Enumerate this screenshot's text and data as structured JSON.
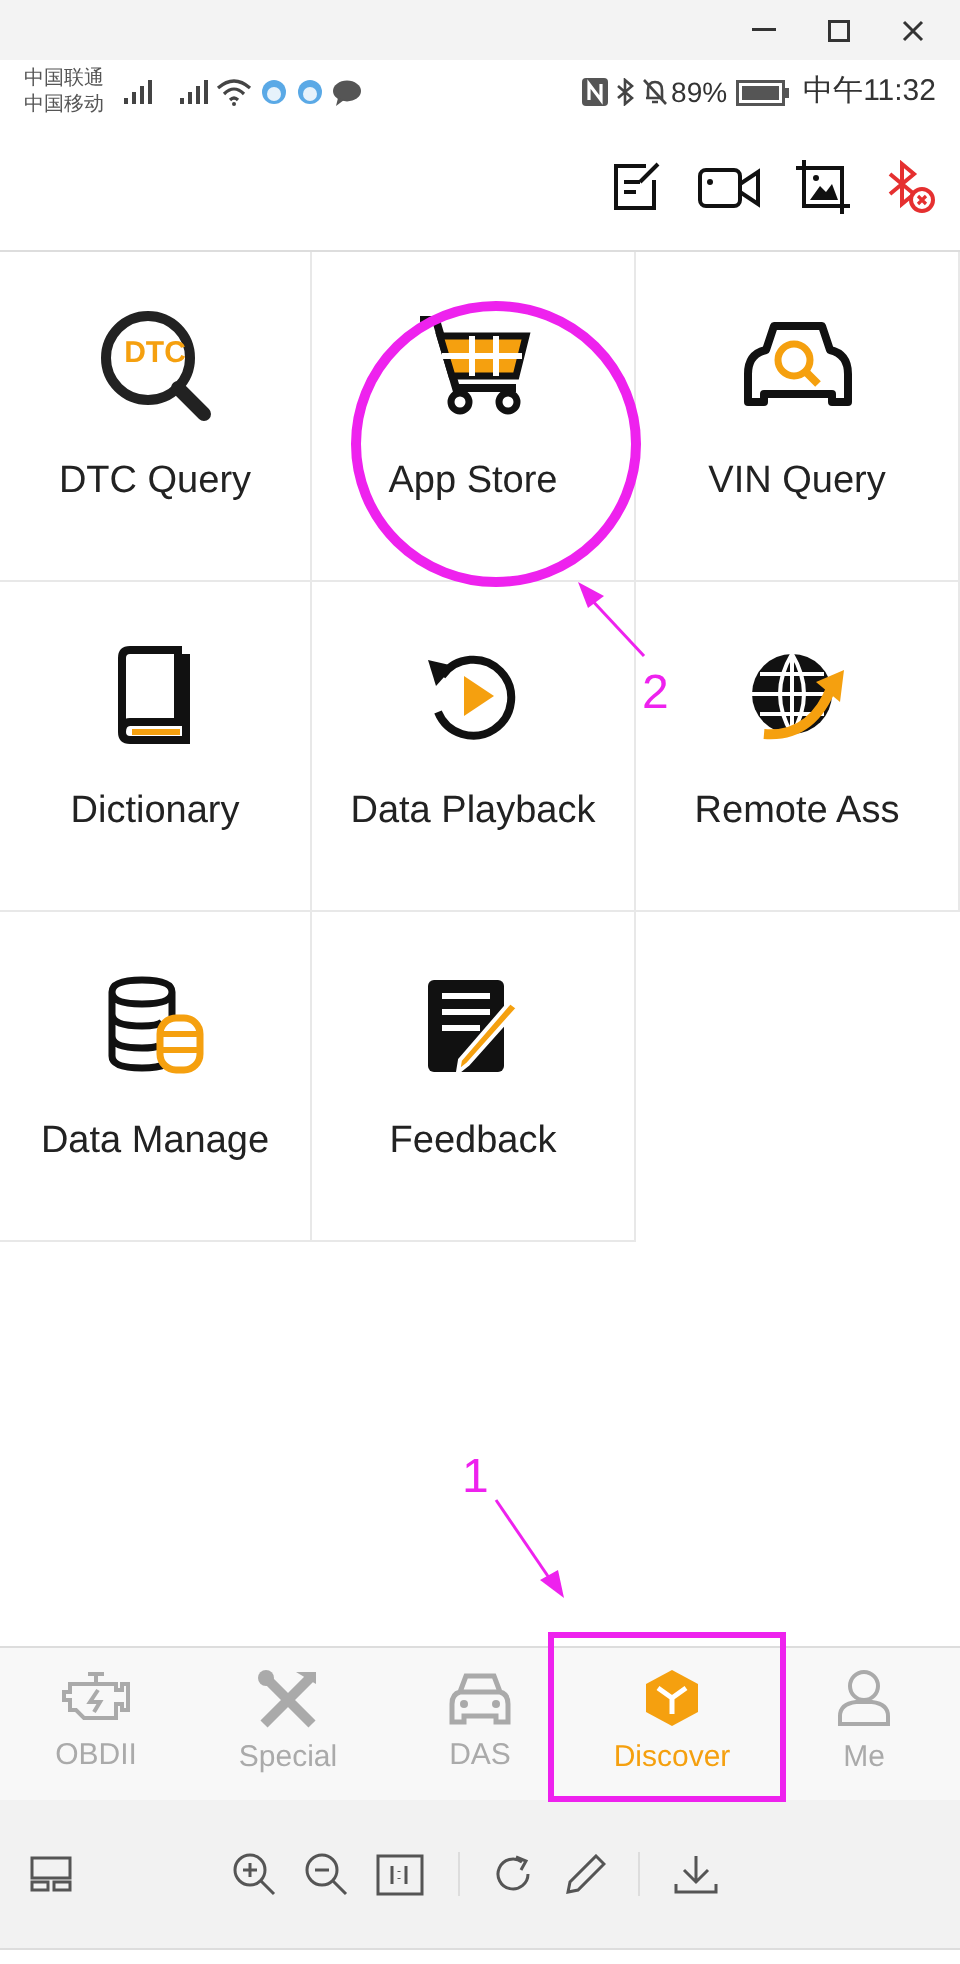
{
  "status_bar": {
    "carriers": [
      "中国联通",
      "中国移动"
    ],
    "battery": "89%",
    "time": "中午11:32"
  },
  "features": [
    {
      "label": "DTC Query",
      "kind": "dtc",
      "icon_text": "DTC"
    },
    {
      "label": "App Store",
      "kind": "cart"
    },
    {
      "label": "VIN Query",
      "kind": "vin"
    },
    {
      "label": "Dictionary",
      "kind": "book"
    },
    {
      "label": "Data Playback",
      "kind": "playback"
    },
    {
      "label": "Remote Ass",
      "kind": "globe"
    },
    {
      "label": "Data Manage",
      "kind": "database"
    },
    {
      "label": "Feedback",
      "kind": "feedback"
    }
  ],
  "tabs": [
    {
      "label": "OBDII",
      "kind": "engine",
      "selected": false
    },
    {
      "label": "Special",
      "kind": "tools",
      "selected": false
    },
    {
      "label": "DAS",
      "kind": "car",
      "selected": false
    },
    {
      "label": "Discover",
      "kind": "cube",
      "selected": true
    },
    {
      "label": "Me",
      "kind": "person",
      "selected": false
    }
  ],
  "annotations": [
    {
      "label": "2",
      "kind": "circle"
    },
    {
      "label": "1",
      "kind": "rect"
    }
  ]
}
